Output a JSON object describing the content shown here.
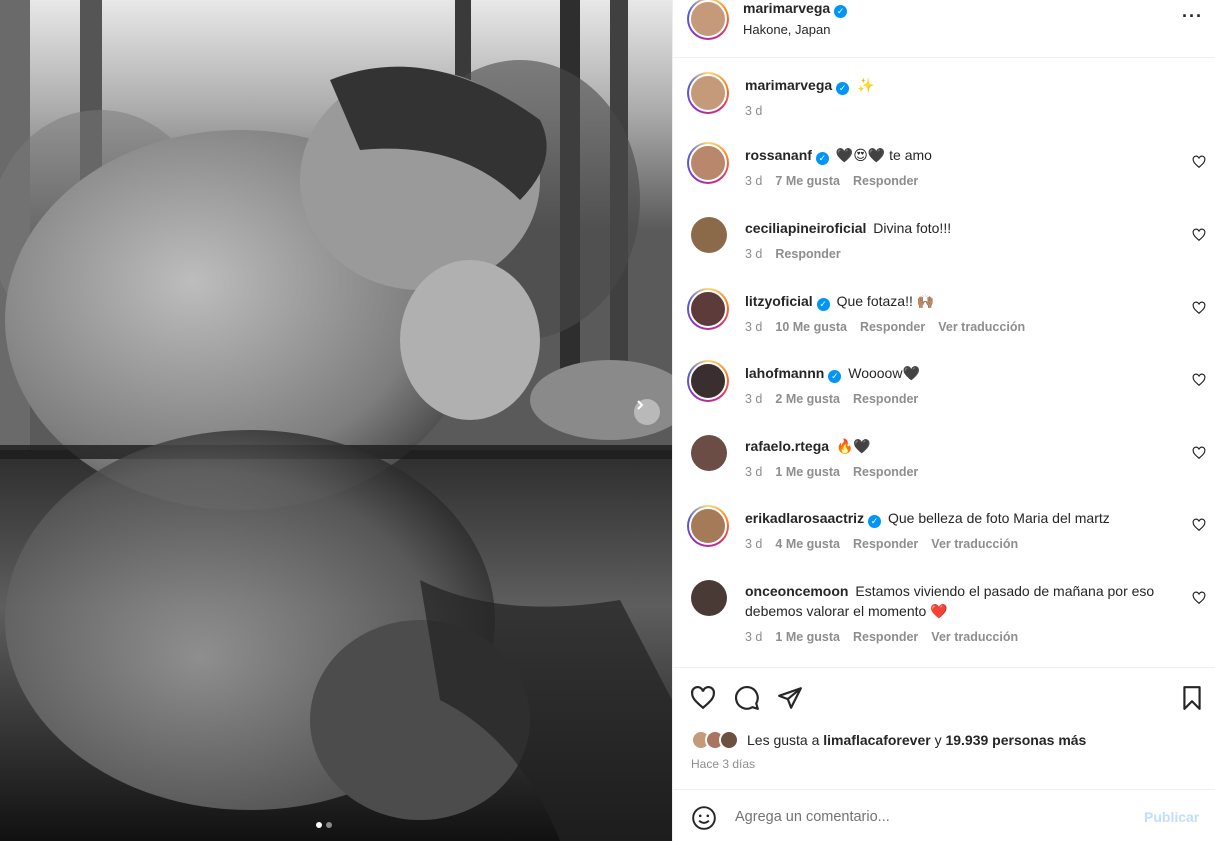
{
  "post": {
    "author": "marimarvega",
    "location": "Hakone, Japan",
    "caption_emoji": "✨",
    "caption_time": "3 d",
    "more_icon": "more-options-icon"
  },
  "carousel": {
    "current": 1,
    "total": 2
  },
  "comments": [
    {
      "user": "rossananf",
      "verified": true,
      "text": "🖤😍🖤 te amo",
      "time": "3 d",
      "likes": "7 Me gusta",
      "reply": "Responder",
      "translate": "",
      "avatar_color": "#b9876c"
    },
    {
      "user": "ceciliapineiroficial",
      "verified": false,
      "text": "Divina foto!!!",
      "time": "3 d",
      "likes": "",
      "reply": "Responder",
      "translate": "",
      "avatar_color": "#8b6a4a"
    },
    {
      "user": "litzyoficial",
      "verified": true,
      "text": "Que fotaza!! 🙌🏽",
      "time": "3 d",
      "likes": "10 Me gusta",
      "reply": "Responder",
      "translate": "Ver traducción",
      "avatar_color": "#5e3b3b"
    },
    {
      "user": "lahofmannn",
      "verified": true,
      "text": "Woooow🖤",
      "time": "3 d",
      "likes": "2 Me gusta",
      "reply": "Responder",
      "translate": "",
      "avatar_color": "#3a2e2e"
    },
    {
      "user": "rafaelo.rtega",
      "verified": false,
      "text": "🔥🖤",
      "time": "3 d",
      "likes": "1 Me gusta",
      "reply": "Responder",
      "translate": "",
      "avatar_color": "#6b4d45"
    },
    {
      "user": "erikadlarosaactriz",
      "verified": true,
      "text": "Que belleza de foto Maria del martz",
      "time": "3 d",
      "likes": "4 Me gusta",
      "reply": "Responder",
      "translate": "Ver traducción",
      "avatar_color": "#a47a58"
    },
    {
      "user": "onceoncemoon",
      "verified": false,
      "text": "Estamos viviendo el pasado de mañana por eso debemos valorar el momento ❤️",
      "time": "3 d",
      "likes": "1 Me gusta",
      "reply": "Responder",
      "translate": "Ver traducción",
      "avatar_color": "#4a3a36"
    }
  ],
  "likes": {
    "prefix": "Les gusta a",
    "user": "limaflacaforever",
    "connector": "y",
    "others": "19.939 personas más",
    "time_ago": "Hace 3 días"
  },
  "composer": {
    "placeholder": "Agrega un comentario...",
    "publish": "Publicar"
  },
  "colors": {
    "verified": "#0095f6",
    "muted": "#8e8e8e",
    "publish_disabled": "#c0dffd",
    "heart_red": "#ed1c3a"
  }
}
